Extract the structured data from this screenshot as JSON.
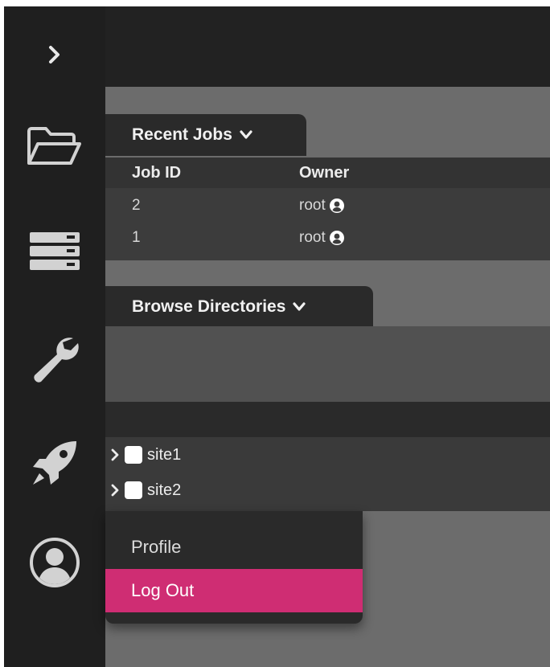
{
  "rail": {
    "items": [
      {
        "icon": "chevron-right-icon"
      },
      {
        "icon": "folder-open-icon"
      },
      {
        "icon": "server-stack-icon"
      },
      {
        "icon": "wrench-icon"
      },
      {
        "icon": "rocket-icon"
      },
      {
        "icon": "user-circle-icon"
      }
    ]
  },
  "recent_jobs": {
    "tab_label": "Recent Jobs",
    "columns": [
      "Job ID",
      "Owner"
    ],
    "rows": [
      {
        "job_id": "2",
        "owner": "root"
      },
      {
        "job_id": "1",
        "owner": "root"
      }
    ]
  },
  "browse": {
    "tab_label": "Browse Directories",
    "tree": [
      {
        "label": "site1"
      },
      {
        "label": "site2"
      }
    ]
  },
  "user_menu": {
    "items": [
      {
        "label": "Profile",
        "active": false
      },
      {
        "label": "Log Out",
        "active": true
      }
    ]
  },
  "colors": {
    "accent": "#cf2d73",
    "rail": "#1f1f1f",
    "panel": "#2a2a2a"
  }
}
